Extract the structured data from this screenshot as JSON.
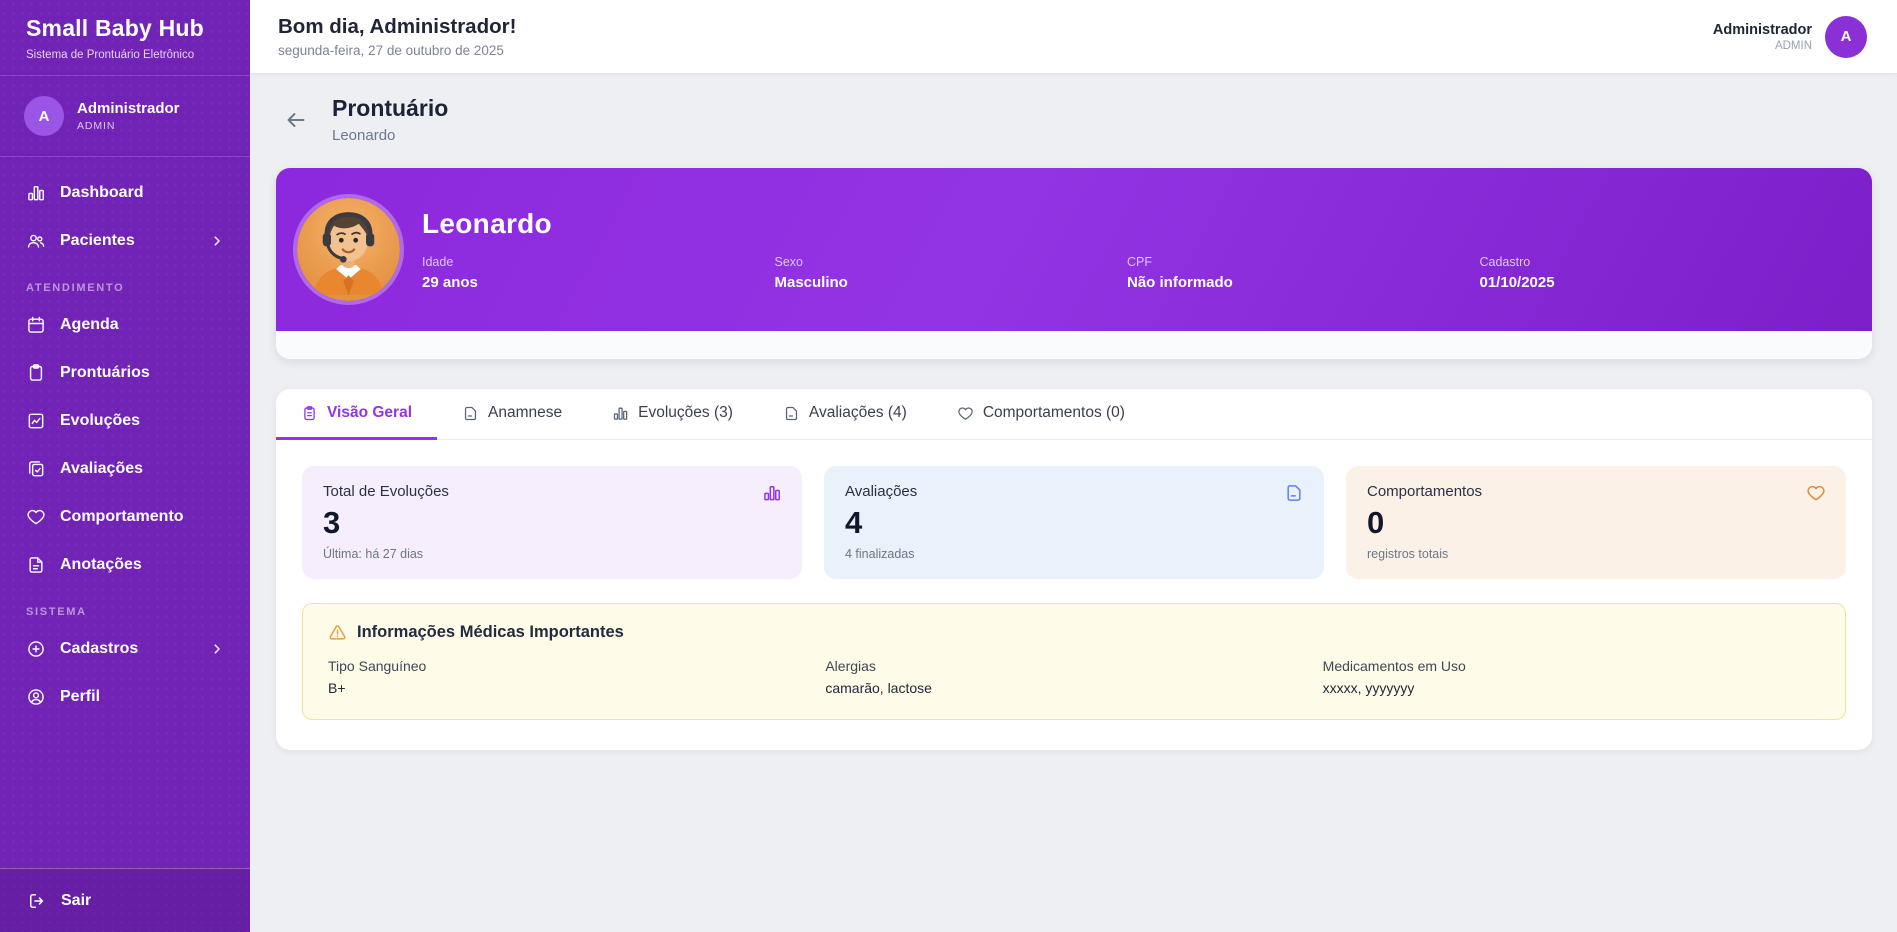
{
  "app": {
    "title": "Small Baby Hub",
    "tagline": "Sistema de Prontuário Eletrônico"
  },
  "sidebar": {
    "user": {
      "initial": "A",
      "name": "Administrador",
      "role": "ADMIN"
    },
    "sections": {
      "atendimento": "ATENDIMENTO",
      "sistema": "SISTEMA"
    },
    "items": {
      "dashboard": "Dashboard",
      "pacientes": "Pacientes",
      "agenda": "Agenda",
      "prontuarios": "Prontuários",
      "evolucoes": "Evoluções",
      "avaliacoes": "Avaliações",
      "comportamento": "Comportamento",
      "anotacoes": "Anotações",
      "cadastros": "Cadastros",
      "perfil": "Perfil",
      "sair": "Sair"
    },
    "icons": [
      "bar-chart-icon",
      "users-icon",
      "calendar-icon",
      "clipboard-icon",
      "trend-chart-icon",
      "clipboard-check-icon",
      "heart-icon",
      "note-icon",
      "plus-circle-icon",
      "user-circle-icon",
      "logout-icon",
      "chevron-right-icon"
    ]
  },
  "header": {
    "greeting": "Bom dia, Administrador!",
    "date": "segunda-feira, 27 de outubro de 2025",
    "user": {
      "name": "Administrador",
      "role": "ADMIN",
      "initial": "A"
    }
  },
  "page": {
    "title": "Prontuário",
    "subtitle": "Leonardo",
    "back_icon": "arrow-left-icon"
  },
  "patient": {
    "name": "Leonardo",
    "idade_label": "Idade",
    "idade": "29 anos",
    "sexo_label": "Sexo",
    "sexo": "Masculino",
    "cpf_label": "CPF",
    "cpf": "Não informado",
    "cadastro_label": "Cadastro",
    "cadastro": "01/10/2025"
  },
  "tabs": {
    "visao_geral": "Visão Geral",
    "anamnese": "Anamnese",
    "evolucoes": "Evoluções (3)",
    "avaliacoes": "Avaliações (4)",
    "comportamentos": "Comportamentos (0)",
    "active": "Visão Geral"
  },
  "stats": {
    "evolucoes": {
      "label": "Total de Evoluções",
      "value": "3",
      "sub": "Última: há 27 dias",
      "icon": "bar-chart-icon",
      "accent": "#9333ea",
      "bg": "#f6eefc"
    },
    "avaliacoes": {
      "label": "Avaliações",
      "value": "4",
      "sub": "4 finalizadas",
      "icon": "document-icon",
      "accent": "#5b82f0",
      "bg": "#e9f1fb"
    },
    "comportamentos": {
      "label": "Comportamentos",
      "value": "0",
      "sub": "registros totais",
      "icon": "heart-icon",
      "accent": "#db8f3e",
      "bg": "#fcf1e7"
    }
  },
  "medical": {
    "title": "Informações Médicas Importantes",
    "icon": "warning-triangle-icon",
    "tipo_sanguineo_label": "Tipo Sanguíneo",
    "tipo_sanguineo": "B+",
    "alergias_label": "Alergias",
    "alergias": "camarão, lactose",
    "medicamentos_label": "Medicamentos em Uso",
    "medicamentos": "xxxxx, yyyyyyy"
  },
  "colors": {
    "sidebar": "#7123b6",
    "banner_gradient_start": "#8c28dd",
    "banner_gradient_end": "#7c1fc9",
    "accent": "#9333ea",
    "warning_bg": "#fefbe8",
    "warning_border": "#f0e39e",
    "page_bg": "#edeff3"
  }
}
